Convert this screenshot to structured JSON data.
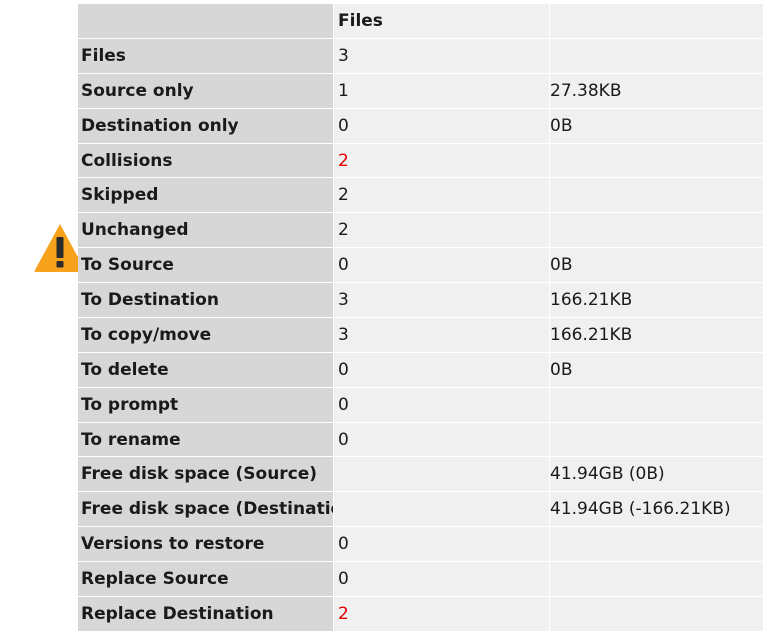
{
  "header": {
    "col1": "Files",
    "col2": ""
  },
  "rows": [
    {
      "label": "Files",
      "count": "3",
      "size": "",
      "count_red": false
    },
    {
      "label": "Source only",
      "count": "1",
      "size": "27.38KB",
      "count_red": false
    },
    {
      "label": "Destination only",
      "count": "0",
      "size": "0B",
      "count_red": false
    },
    {
      "label": "Collisions",
      "count": "2",
      "size": "",
      "count_red": true
    },
    {
      "label": "Skipped",
      "count": "2",
      "size": "",
      "count_red": false
    },
    {
      "label": "Unchanged",
      "count": "2",
      "size": "",
      "count_red": false
    },
    {
      "label": "To Source",
      "count": "0",
      "size": "0B",
      "count_red": false
    },
    {
      "label": "To Destination",
      "count": "3",
      "size": "166.21KB",
      "count_red": false
    },
    {
      "label": "To copy/move",
      "count": "3",
      "size": "166.21KB",
      "count_red": false
    },
    {
      "label": "To delete",
      "count": "0",
      "size": "0B",
      "count_red": false
    },
    {
      "label": "To prompt",
      "count": "0",
      "size": "",
      "count_red": false
    },
    {
      "label": "To rename",
      "count": "0",
      "size": "",
      "count_red": false
    },
    {
      "label": "Free disk space (Source)",
      "count": "",
      "size": "41.94GB (0B)",
      "count_red": false
    },
    {
      "label": "Free disk space (Destinatic",
      "count": "",
      "size": "41.94GB (-166.21KB)",
      "count_red": false
    },
    {
      "label": "Versions to restore",
      "count": "0",
      "size": "",
      "count_red": false
    },
    {
      "label": "Replace Source",
      "count": "0",
      "size": "",
      "count_red": false
    },
    {
      "label": "Replace Destination",
      "count": "2",
      "size": "",
      "count_red": true
    }
  ],
  "icons": {
    "warning": "warning-triangle-icon"
  },
  "colors": {
    "header_bg": "#d7d7d7",
    "cell_bg": "#f0f0f0",
    "alert": "#e00000",
    "warning": "#f5a623"
  }
}
